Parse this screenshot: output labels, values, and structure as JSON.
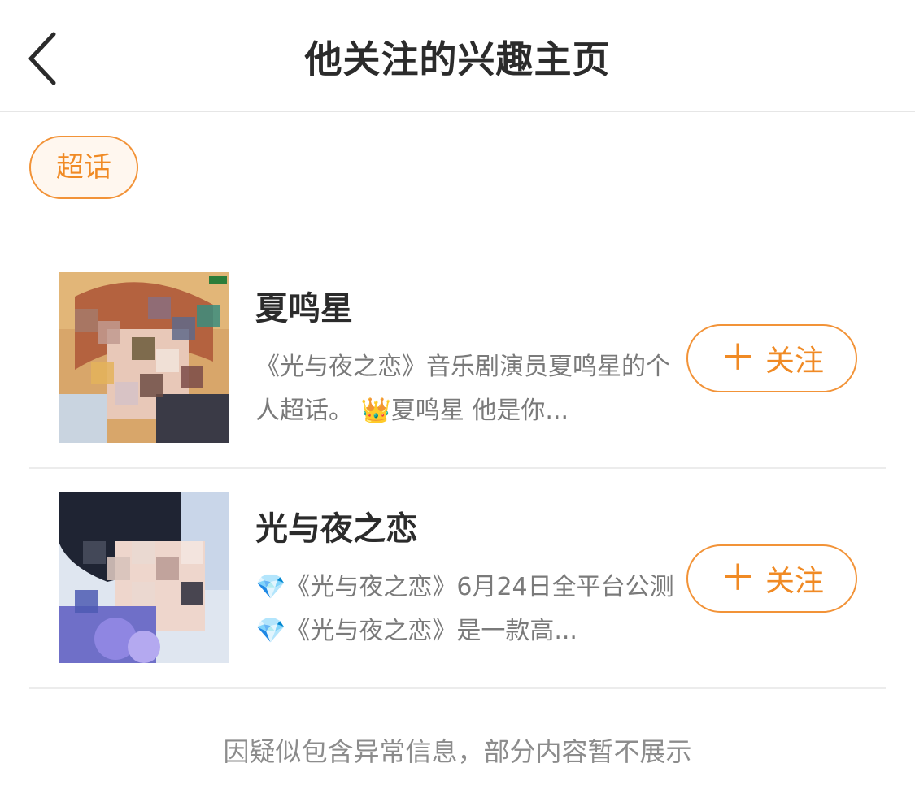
{
  "header": {
    "title": "他关注的兴趣主页",
    "back_icon": "chevron-left-icon"
  },
  "filter": {
    "chip_label": "超话"
  },
  "cards": [
    {
      "title": "夏鸣星",
      "description": "《光与夜之恋》音乐剧演员夏鸣星的个人超话。 👑夏鸣星 他是你...",
      "follow_label": "关注",
      "follow_icon": "plus-icon"
    },
    {
      "title": "光与夜之恋",
      "description": "💎《光与夜之恋》6月24日全平台公测 💎《光与夜之恋》是一款高...",
      "follow_label": "关注",
      "follow_icon": "plus-icon"
    }
  ],
  "notice": "因疑似包含异常信息，部分内容暂不展示",
  "colors": {
    "accent": "#f08a24",
    "accent_border": "#f29338",
    "chip_bg": "#fff7ef",
    "divider": "#ececec",
    "title_text": "#2b2b2b",
    "secondary_text": "#7a7a7a"
  }
}
